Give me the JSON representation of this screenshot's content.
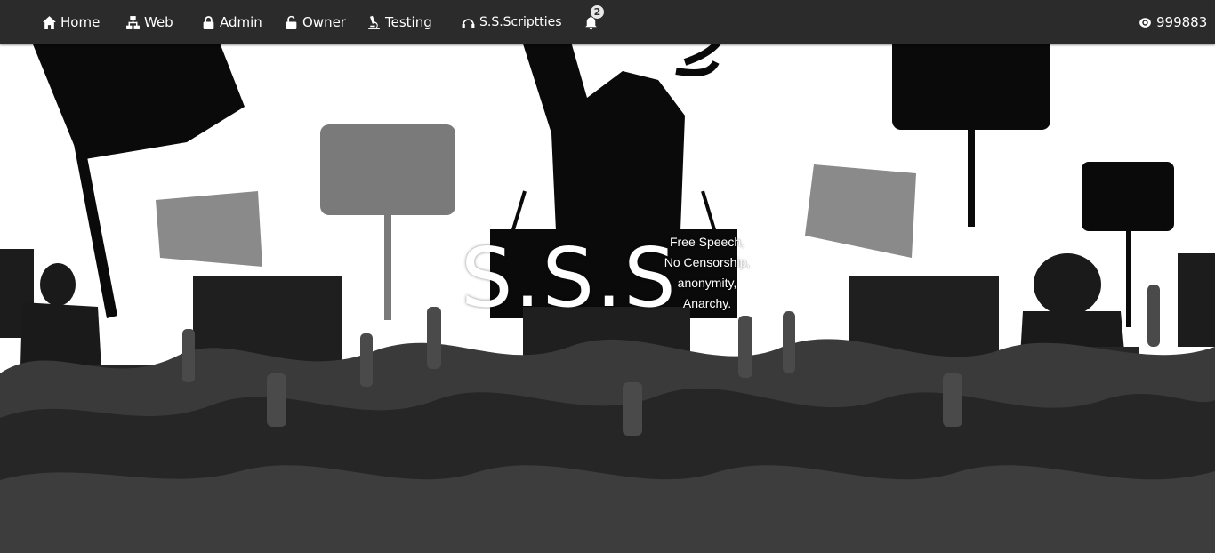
{
  "nav": {
    "items": [
      {
        "label": "Home",
        "icon": "home-icon"
      },
      {
        "label": "Web",
        "icon": "sitemap-icon"
      },
      {
        "label": "Admin",
        "icon": "lock-icon"
      },
      {
        "label": "Owner",
        "icon": "unlock-icon"
      },
      {
        "label": "Testing",
        "icon": "microscope-icon"
      },
      {
        "label": "S.S.Scriptties",
        "icon": "headset-icon"
      }
    ],
    "notifications": {
      "count": "2",
      "icon": "bell-icon"
    },
    "user": {
      "label": "999883",
      "icon": "eye-icon"
    }
  },
  "hero": {
    "title": "S.S.S",
    "slogans": [
      "Free Speech,",
      "No Censorship,",
      "anonymity,",
      "Anarchy."
    ]
  },
  "colors": {
    "navbar_bg": "#2b2b2b",
    "text": "#ffffff",
    "silhouette_dark": "#0a0a0a",
    "silhouette_mid": "#2a2a2a",
    "silhouette_gray": "#7a7a7a"
  }
}
